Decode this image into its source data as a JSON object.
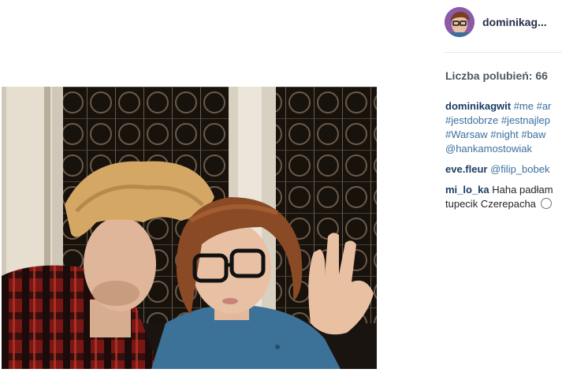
{
  "header": {
    "username": "dominikag..."
  },
  "likes": {
    "text": "Liczba polubień: 66"
  },
  "caption": {
    "user": "dominikagwit",
    "line1_tags": "#me #ar",
    "line2_tags": "#jestdobrze #jestnajlep",
    "line3_tags": "#Warsaw #night #baw",
    "line4_tags": "@hankamostowiak"
  },
  "comments": [
    {
      "user": "eve.fleur",
      "text": "@filip_bobek"
    },
    {
      "user": "mi_lo_ka",
      "text_line1": "Haha padłam",
      "text_line2": "tupecik Czerepacha"
    }
  ],
  "icons": {
    "avatar": "profile-photo",
    "emoji": "smiley-face-icon"
  },
  "colors": {
    "username": "#262f4a",
    "hashtag": "#3a6f9d",
    "comment_user": "#1c3d64",
    "likes": "#505761"
  }
}
